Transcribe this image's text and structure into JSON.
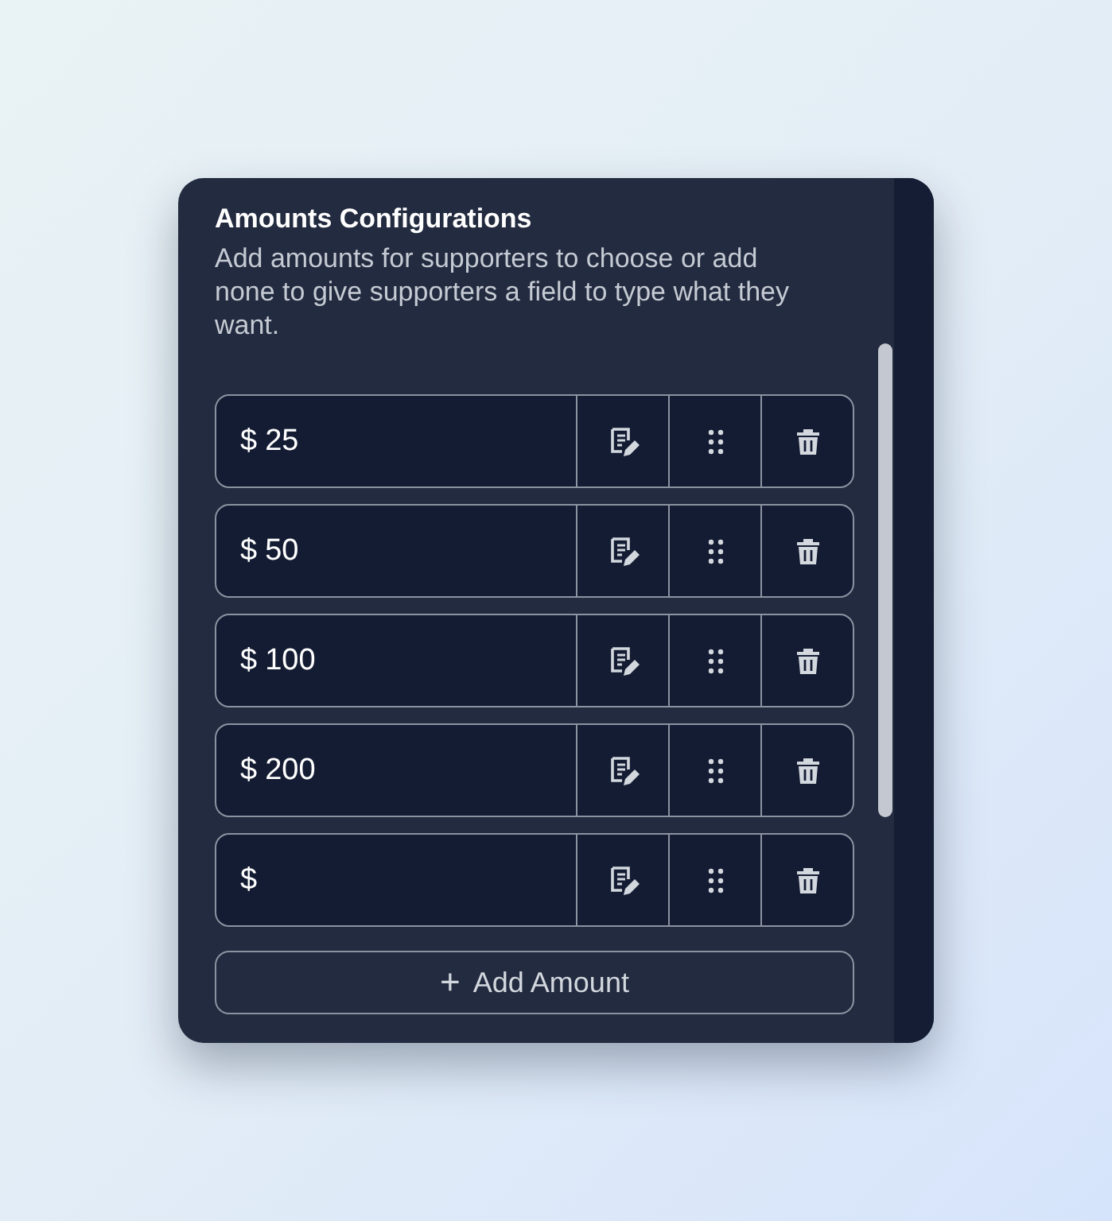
{
  "panel": {
    "title": "Amounts Configurations",
    "description": "Add amounts for supporters to choose or add none to give supporters a field to type what they want."
  },
  "amounts": [
    {
      "prefix": "$",
      "value": "25"
    },
    {
      "prefix": "$",
      "value": "50"
    },
    {
      "prefix": "$",
      "value": "100"
    },
    {
      "prefix": "$",
      "value": "200"
    },
    {
      "prefix": "$"
    }
  ],
  "add_button": {
    "icon": "+",
    "label": "Add Amount"
  }
}
